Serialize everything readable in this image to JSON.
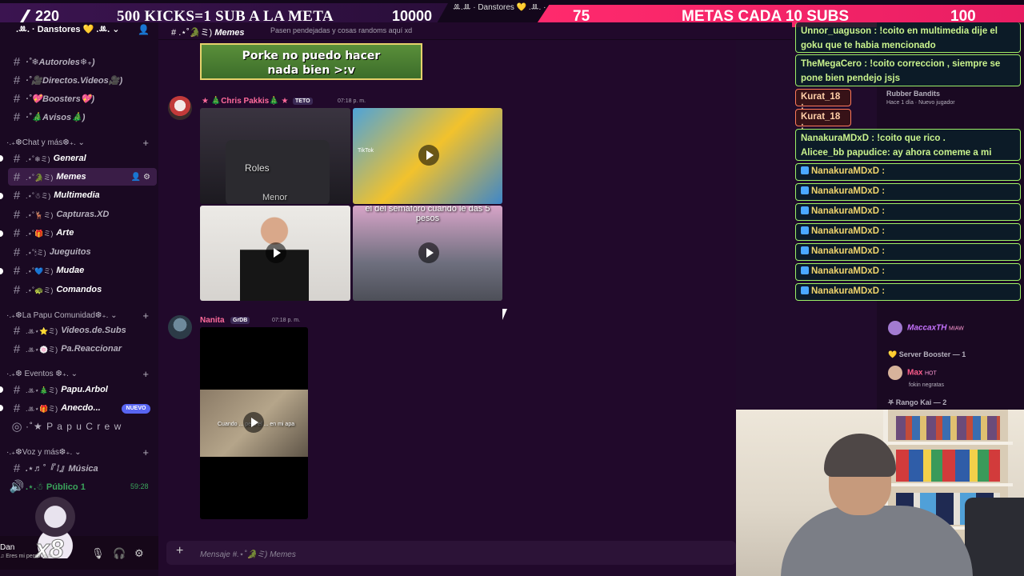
{
  "topbar": {
    "left_goal": {
      "current": "220",
      "text": "500 KICKS=1 SUB A LA META",
      "target": "10000"
    },
    "right_goal": {
      "current": "75",
      "text": "METAS CADA 10 SUBS",
      "target": "100"
    },
    "window_title": "ꔛ.⁠ꔛ · Danstores 💛 .ꔛ. ·"
  },
  "sidebar": {
    "server_name": ".ꔛ. · Danstores 💛 .ꔛ. ⌄",
    "channels_top": [
      {
        "label": "·˚❄︎Autoroles❄︎₊)",
        "icon": "hash"
      },
      {
        "label": "·˚🎥Directos.Videos🎥)",
        "icon": "hash"
      },
      {
        "label": "·˚💖Boosters💖)",
        "icon": "hash"
      },
      {
        "label": "·˚🎄Avisos🎄)",
        "icon": "hash"
      }
    ],
    "cat_chat": "·.₊❆Chat y más❆₊.  ⌄",
    "channels_chat": [
      {
        "label": "General",
        "prefix": ".⋆˚❄︎ミ)"
      },
      {
        "label": "Memes",
        "prefix": ".⋆˚🐊ミ)"
      },
      {
        "label": "Multimedia",
        "prefix": ".⋆˚☃ミ)"
      },
      {
        "label": "Capturas.XD",
        "prefix": ".⋆˚🦌ミ)"
      },
      {
        "label": "Arte",
        "prefix": ".⋆˚🎁ミ)"
      },
      {
        "label": "Jueguitos",
        "prefix": ".⋆˚🕯ミ)"
      },
      {
        "label": "Mudae",
        "prefix": ".⋆˚💙ミ)"
      },
      {
        "label": "Comandos",
        "prefix": ".⋆˚🐢ミ)"
      }
    ],
    "cat_papu": "·.₊❆La Papu Comunidad❆₊.  ⌄",
    "channels_papu": [
      {
        "label": "Videos.de.Subs",
        "prefix": ".ꔛ⋆⭐ミ)"
      },
      {
        "label": "Pa.Reaccionar",
        "prefix": ".ꔛ⋆🍥ミ)"
      }
    ],
    "cat_eventos": "·.₊❆ Eventos ❆₊.  ⌄",
    "channels_eventos": [
      {
        "label": "Papu.Arbol",
        "prefix": ".ꔛ⋆🎄ミ)"
      },
      {
        "label": "Anecdo...",
        "prefix": ".ꔛ⋆🎁ミ)"
      }
    ],
    "papu_crew": "·˚★  P a p u  C r e w",
    "cat_voz": "·.₊❆Voz y más❆₊.  ⌄",
    "voice_musica": ".⋆♬˚『 ⁞』Música",
    "voice_publico": ".⋆.☃ Público 1",
    "voice_time": "59:28",
    "new_badge": "NUEVO",
    "user": {
      "name": "Dan",
      "status": "♫ Eres mi persona fa...",
      "boost": "x8"
    }
  },
  "chat": {
    "channel_name": ".⋆˚🐊ミ)",
    "channel_title": "Memes",
    "topic": "Pasen pendejadas y cosas randoms aquí xd",
    "meme_top_lines": [
      "Porke no puedo hacer",
      "nada bien >:v"
    ],
    "msg1": {
      "author": "★ 🎄Chris Pakkis🎄 ★",
      "tag": "TETO",
      "time": "07:18 p. m."
    },
    "roles_label": "Roles",
    "menor_label": "Menor",
    "semaforo_caption": "el del semáforo cuando le das 5 pesos",
    "msg2": {
      "author": "Nanita",
      "tag": "GrDB",
      "time": "07:18 p. m."
    },
    "video_caption": "Cuando ... pero el ... en mi apa",
    "composer_placeholder": "Mensaje #.⋆˚🐊ミ)  Memes",
    "tiktok_label": "TikTok"
  },
  "overlay": {
    "row_top": {
      "name": "Unnor_uaguson",
      "text": ": !coito en multimedia dije el goku que te habia mencionado"
    },
    "row_mega": {
      "name": "TheMegaCero",
      "text": ": !coito correccion , siempre se pone bien pendejo jsjs"
    },
    "kurat_name": "Kurat_18 :",
    "nana_big": {
      "name": "NanakuraMDxD",
      "text": ": !coito que rico .",
      "line2": "Alicee_bb papudice: ay ahora comeme a mi"
    },
    "nana_name": "NanakuraMDxD :"
  },
  "members": {
    "rubber": {
      "name": "Rubber Bandits",
      "sub": "Hace 1 día · Nuevo jugador"
    },
    "macca": {
      "name": "MaccaxTH",
      "tag": "MIAW"
    },
    "server_booster": "Server Booster — 1",
    "max": {
      "name": "Max",
      "tag": "HOT",
      "sub": "fokin negratas"
    },
    "rango_kai": "Rango Kai — 2"
  }
}
